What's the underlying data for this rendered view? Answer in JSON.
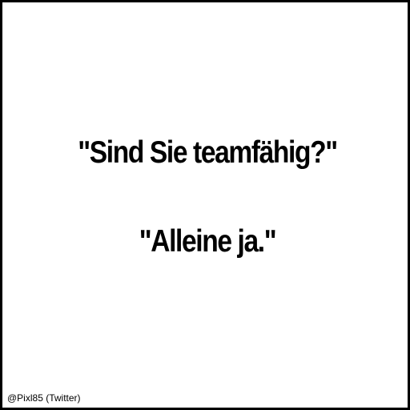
{
  "meme": {
    "question": "\"Sind Sie teamfähig?\"",
    "answer": "\"Alleine ja.\""
  },
  "credit": {
    "text": "@Pixl85 (Twitter)"
  },
  "colors": {
    "background": "#ffffff",
    "text": "#000000",
    "border": "#000000"
  }
}
